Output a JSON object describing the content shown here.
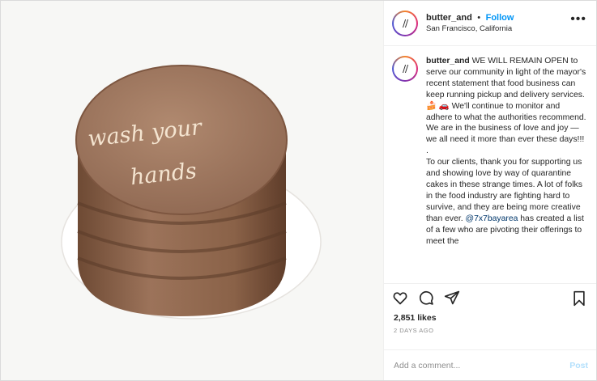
{
  "post": {
    "username": "butter_and",
    "separator": "•",
    "follow_label": "Follow",
    "location": "San Francisco, California",
    "avatar_mark": "//",
    "more_label": "•••"
  },
  "image": {
    "cake_text_line1": "wash your",
    "cake_text_line2": "hands"
  },
  "caption": {
    "username": "butter_and",
    "paragraph1": "WE WILL REMAIN OPEN to serve our community in light of the mayor's recent statement that food business can keep running pickup and delivery services. 🍰 🚗 We'll continue to monitor and adhere to what the authorities recommend. We are in the business of love and joy — we all need it more than ever these days!!!",
    "divider": ".",
    "paragraph2_before": "To our clients, thank you for supporting us and showing love by way of quarantine cakes in these strange times. A lot of folks in the food industry are fighting hard to survive, and they are being more creative than ever. ",
    "mention": "@7x7bayarea",
    "paragraph2_after": " has created a list of a few who are pivoting their offerings to meet the"
  },
  "actions": {
    "icons": [
      "heart-icon",
      "comment-icon",
      "share-icon",
      "bookmark-icon"
    ]
  },
  "stats": {
    "likes": "2,851 likes",
    "time": "2 DAYS AGO"
  },
  "comment_box": {
    "placeholder": "Add a comment...",
    "post_label": "Post"
  }
}
